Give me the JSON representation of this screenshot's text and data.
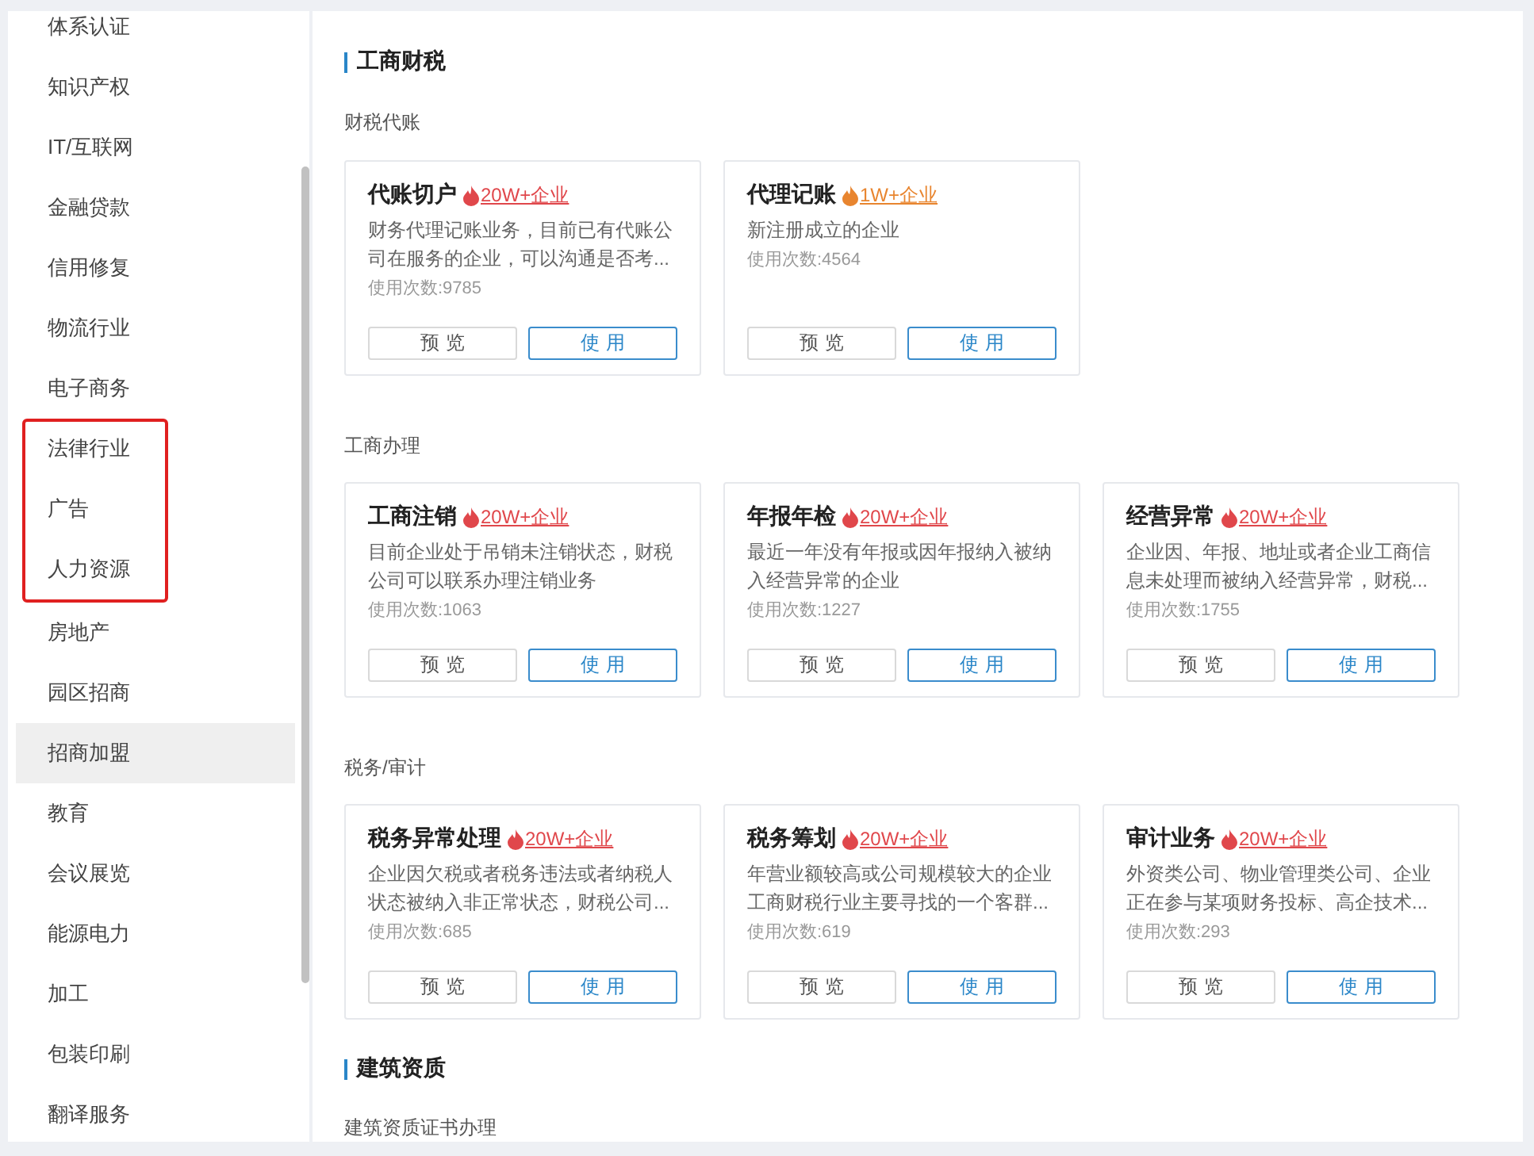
{
  "sidebar": {
    "entries": [
      {
        "kind": "item",
        "label": "体系认证",
        "hovered": false
      },
      {
        "kind": "item",
        "label": "知识产权",
        "hovered": false
      },
      {
        "kind": "item",
        "label": "IT/互联网",
        "hovered": false
      },
      {
        "kind": "item",
        "label": "金融贷款",
        "hovered": false
      },
      {
        "kind": "item",
        "label": "信用修复",
        "hovered": false
      },
      {
        "kind": "item",
        "label": "物流行业",
        "hovered": false
      },
      {
        "kind": "item",
        "label": "电子商务",
        "hovered": false
      },
      {
        "kind": "highlight_frame",
        "items": [
          {
            "label": "法律行业",
            "hovered": false
          },
          {
            "label": "广告",
            "hovered": false
          },
          {
            "label": "人力资源",
            "hovered": false
          }
        ]
      },
      {
        "kind": "item",
        "label": "房地产",
        "hovered": false
      },
      {
        "kind": "item",
        "label": "园区招商",
        "hovered": false
      },
      {
        "kind": "item",
        "label": "招商加盟",
        "hovered": true
      },
      {
        "kind": "item",
        "label": "教育",
        "hovered": false
      },
      {
        "kind": "item",
        "label": "会议展览",
        "hovered": false
      },
      {
        "kind": "item",
        "label": "能源电力",
        "hovered": false
      },
      {
        "kind": "item",
        "label": "加工",
        "hovered": false
      },
      {
        "kind": "item",
        "label": "包装印刷",
        "hovered": false
      },
      {
        "kind": "item",
        "label": "翻译服务",
        "hovered": false
      }
    ]
  },
  "sections": [
    {
      "title": "工商财税",
      "groups": [
        {
          "label": "财税代账",
          "cards": [
            {
              "title": "代账切户",
              "badge": {
                "text": "20W+企业",
                "color": "#e0474b"
              },
              "description": "财务代理记账业务，目前已有代账公司在服务的企业，可以沟通是否考...",
              "usage": "使用次数:9785",
              "buttons": [
                {
                  "label": "预览",
                  "kind": "secondary"
                },
                {
                  "label": "使用",
                  "kind": "primary"
                }
              ]
            },
            {
              "title": "代理记账",
              "badge": {
                "text": "1W+企业",
                "color": "#e8852f"
              },
              "description": "新注册成立的企业",
              "usage": "使用次数:4564",
              "buttons": [
                {
                  "label": "预览",
                  "kind": "secondary"
                },
                {
                  "label": "使用",
                  "kind": "primary"
                }
              ]
            }
          ]
        },
        {
          "label": "工商办理",
          "cards": [
            {
              "title": "工商注销",
              "badge": {
                "text": "20W+企业",
                "color": "#e0474b"
              },
              "description": "目前企业处于吊销未注销状态，财税公司可以联系办理注销业务",
              "usage": "使用次数:1063",
              "buttons": [
                {
                  "label": "预览",
                  "kind": "secondary"
                },
                {
                  "label": "使用",
                  "kind": "primary"
                }
              ]
            },
            {
              "title": "年报年检",
              "badge": {
                "text": "20W+企业",
                "color": "#e0474b"
              },
              "description": "最近一年没有年报或因年报纳入被纳入经营异常的企业",
              "usage": "使用次数:1227",
              "buttons": [
                {
                  "label": "预览",
                  "kind": "secondary"
                },
                {
                  "label": "使用",
                  "kind": "primary"
                }
              ]
            },
            {
              "title": "经营异常",
              "badge": {
                "text": "20W+企业",
                "color": "#e0474b"
              },
              "description": "企业因、年报、地址或者企业工商信息未处理而被纳入经营异常，财税...",
              "usage": "使用次数:1755",
              "buttons": [
                {
                  "label": "预览",
                  "kind": "secondary"
                },
                {
                  "label": "使用",
                  "kind": "primary"
                }
              ]
            }
          ]
        },
        {
          "label": "税务/审计",
          "cards": [
            {
              "title": "税务异常处理",
              "badge": {
                "text": "20W+企业",
                "color": "#e0474b"
              },
              "description": "企业因欠税或者税务违法或者纳税人状态被纳入非正常状态，财税公司...",
              "usage": "使用次数:685",
              "buttons": [
                {
                  "label": "预览",
                  "kind": "secondary"
                },
                {
                  "label": "使用",
                  "kind": "primary"
                }
              ]
            },
            {
              "title": "税务筹划",
              "badge": {
                "text": "20W+企业",
                "color": "#e0474b"
              },
              "description": "年营业额较高或公司规模较大的企业工商财税行业主要寻找的一个客群...",
              "usage": "使用次数:619",
              "buttons": [
                {
                  "label": "预览",
                  "kind": "secondary"
                },
                {
                  "label": "使用",
                  "kind": "primary"
                }
              ]
            },
            {
              "title": "审计业务",
              "badge": {
                "text": "20W+企业",
                "color": "#e0474b"
              },
              "description": "外资类公司、物业管理类公司、企业正在参与某项财务投标、高企技术...",
              "usage": "使用次数:293",
              "buttons": [
                {
                  "label": "预览",
                  "kind": "secondary"
                },
                {
                  "label": "使用",
                  "kind": "primary"
                }
              ]
            }
          ]
        }
      ]
    },
    {
      "title": "建筑资质",
      "groups": [
        {
          "label": "建筑资质证书办理"
        }
      ]
    }
  ]
}
